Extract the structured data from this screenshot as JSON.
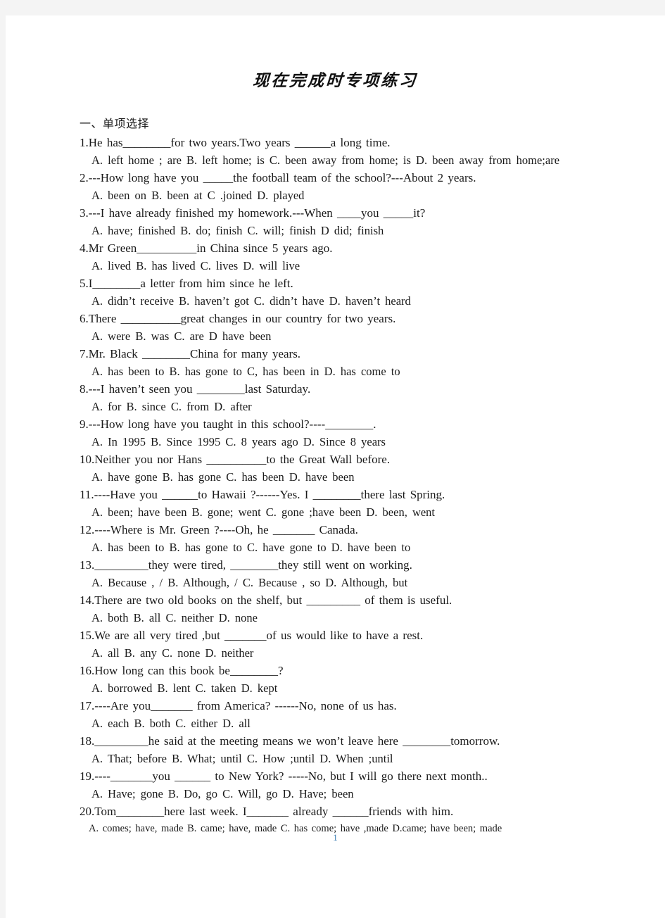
{
  "document": {
    "title": "现在完成时专项练习",
    "section_heading": "一、单项选择",
    "page_number": "1",
    "page_number_color": "#3d7fb5",
    "text_color": "#1a1a1a",
    "page_background": "#ffffff",
    "margin_background": "#f4f4f4"
  },
  "questions": [
    {
      "stem": "1.He has________for two years.Two years ______a  long time.",
      "options": "A. left home ; are   B. left home; is   C. been away from home; is   D. been away from home;are"
    },
    {
      "stem": "2.---How long have you _____the football team of the school?---About 2 years.",
      "options": "A. been on   B. been at   C .joined   D. played"
    },
    {
      "stem": "3.---I have already finished my homework.---When ____you _____it?",
      "options": "A. have; finished   B. do; finish    C. will; finish   D did; finish"
    },
    {
      "stem": "4.Mr Green__________in China since 5 years ago.",
      "options": "A. lived         B. has lived   C. lives   D. will live"
    },
    {
      "stem": "5.I________a letter from him since he left.",
      "options": "A. didn’t receive    B. haven’t got    C. didn’t have    D. haven’t heard"
    },
    {
      "stem": "6.There __________great changes in our country for two years.",
      "options": "A. were    B. was     C. are    D have been"
    },
    {
      "stem": "7.Mr. Black ________China for many years.",
      "options": "A. has been to B. has gone to   C, has been in   D. has come to"
    },
    {
      "stem": "8.---I haven’t seen you ________last Saturday.",
      "options": "A. for    B. since    C. from    D. after"
    },
    {
      "stem": "9.---How long have you taught in this school?----________.",
      "options": "A. In 1995    B. Since 1995    C. 8 years ago    D. Since 8 years"
    },
    {
      "stem": "10.Neither you nor Hans __________to the Great Wall before.",
      "options": "A. have gone   B. has gone    C. has been   D. have been"
    },
    {
      "stem": "11.----Have you ______to Hawaii ?------Yes. I ________there last Spring.",
      "options": "A. been; have been    B. gone; went   C. gone ;have been    D. been, went"
    },
    {
      "stem": "12.----Where is Mr. Green ?----Oh, he _______ Canada.",
      "options": "A. has been to      B. has gone to    C. have gone to   D. have been to"
    },
    {
      "stem": "13._________they  were  tired, ________they still went on working.",
      "options": "A. Because , /    B. Although, /     C. Because , so    D. Although, but"
    },
    {
      "stem": "14.There are two old books on the shelf, but _________ of them is useful.",
      "options": "A. both    B. all   C. neither    D. none"
    },
    {
      "stem": "15.We are all very tired ,but _______of us would like to have a rest.",
      "options": "A. all    B. any    C. none    D. neither"
    },
    {
      "stem": "16.How long can this book be________?",
      "options": "A. borrowed    B. lent    C. taken    D. kept"
    },
    {
      "stem": "17.----Are you_______ from America? ------No, none of us has.",
      "options": "A. each     B. both    C. either   D. all"
    },
    {
      "stem": "18._________he said at the meeting means we won’t leave here ________tomorrow.",
      "options": "A. That; before    B. What; until     C. How ;until   D. When ;until"
    },
    {
      "stem": "19.----_______you ______ to New York? -----No, but I will go there next month..",
      "options": "A. Have; gone   B. Do, go   C. Will, go    D. Have; been"
    },
    {
      "stem": "20.Tom________here last week. I_______ already ______friends with him.",
      "options": "A. comes; have, made   B. came; have, made    C. has come; have ,made    D.came; have been; made",
      "options_small": true
    }
  ]
}
